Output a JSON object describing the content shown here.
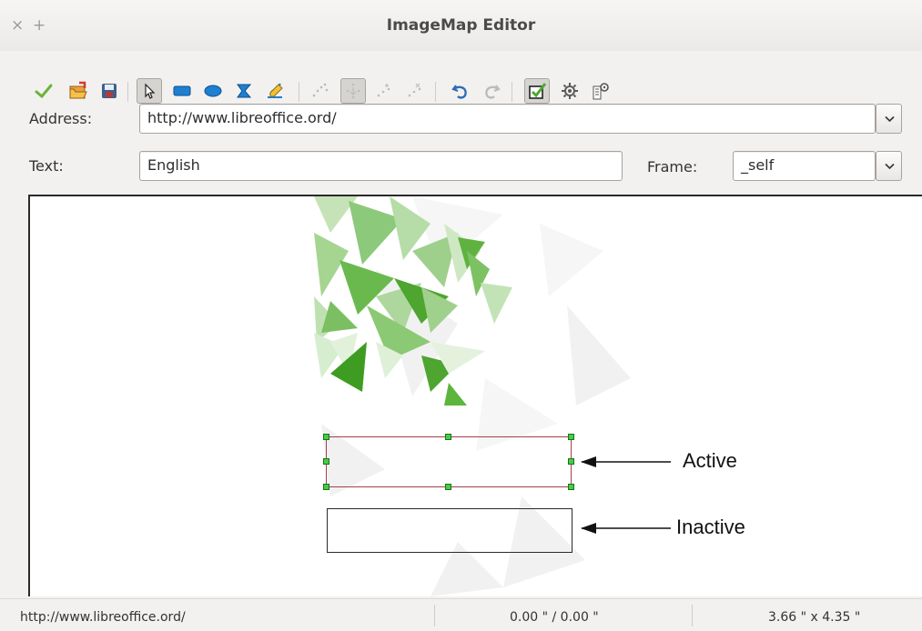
{
  "window": {
    "title": "ImageMap Editor",
    "close_glyph": "×",
    "add_glyph": "+"
  },
  "toolbar": {
    "icons": [
      "apply-icon",
      "open-icon",
      "save-icon",
      "select-icon",
      "rectangle-icon",
      "ellipse-icon",
      "polygon-icon",
      "freeform-polygon-icon",
      "edit-points-icon",
      "move-points-icon",
      "insert-points-icon",
      "delete-points-icon",
      "undo-icon",
      "redo-icon",
      "active-icon",
      "macro-icon",
      "properties-icon"
    ]
  },
  "form": {
    "address_label": "Address:",
    "address_value": "http://www.libreoffice.ord/",
    "text_label": "Text:",
    "text_value": "English",
    "frame_label": "Frame:",
    "frame_value": "_self"
  },
  "canvas": {
    "active_label": "Active",
    "inactive_label": "Inactive"
  },
  "status": {
    "url": "http://www.libreoffice.ord/",
    "position": "0.00 \" / 0.00 \"",
    "size": "3.66 \" x 4.35 \""
  },
  "colors": {
    "active_border": "#a3404a",
    "handle": "#40d040",
    "accent_green": "#5cb85c"
  }
}
